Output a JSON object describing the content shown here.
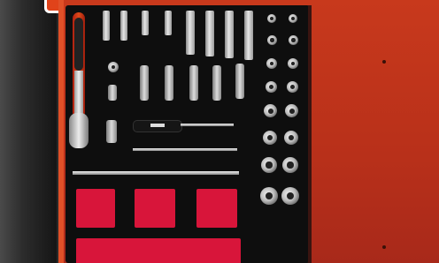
{
  "scene": {
    "subject": "tool-drawer",
    "colors": {
      "drawer": "#c8391c",
      "foam": "#0e0e0e",
      "slot": "#d8153a",
      "chrome": "#d0d0d0",
      "handle": "#e04a1a"
    }
  }
}
